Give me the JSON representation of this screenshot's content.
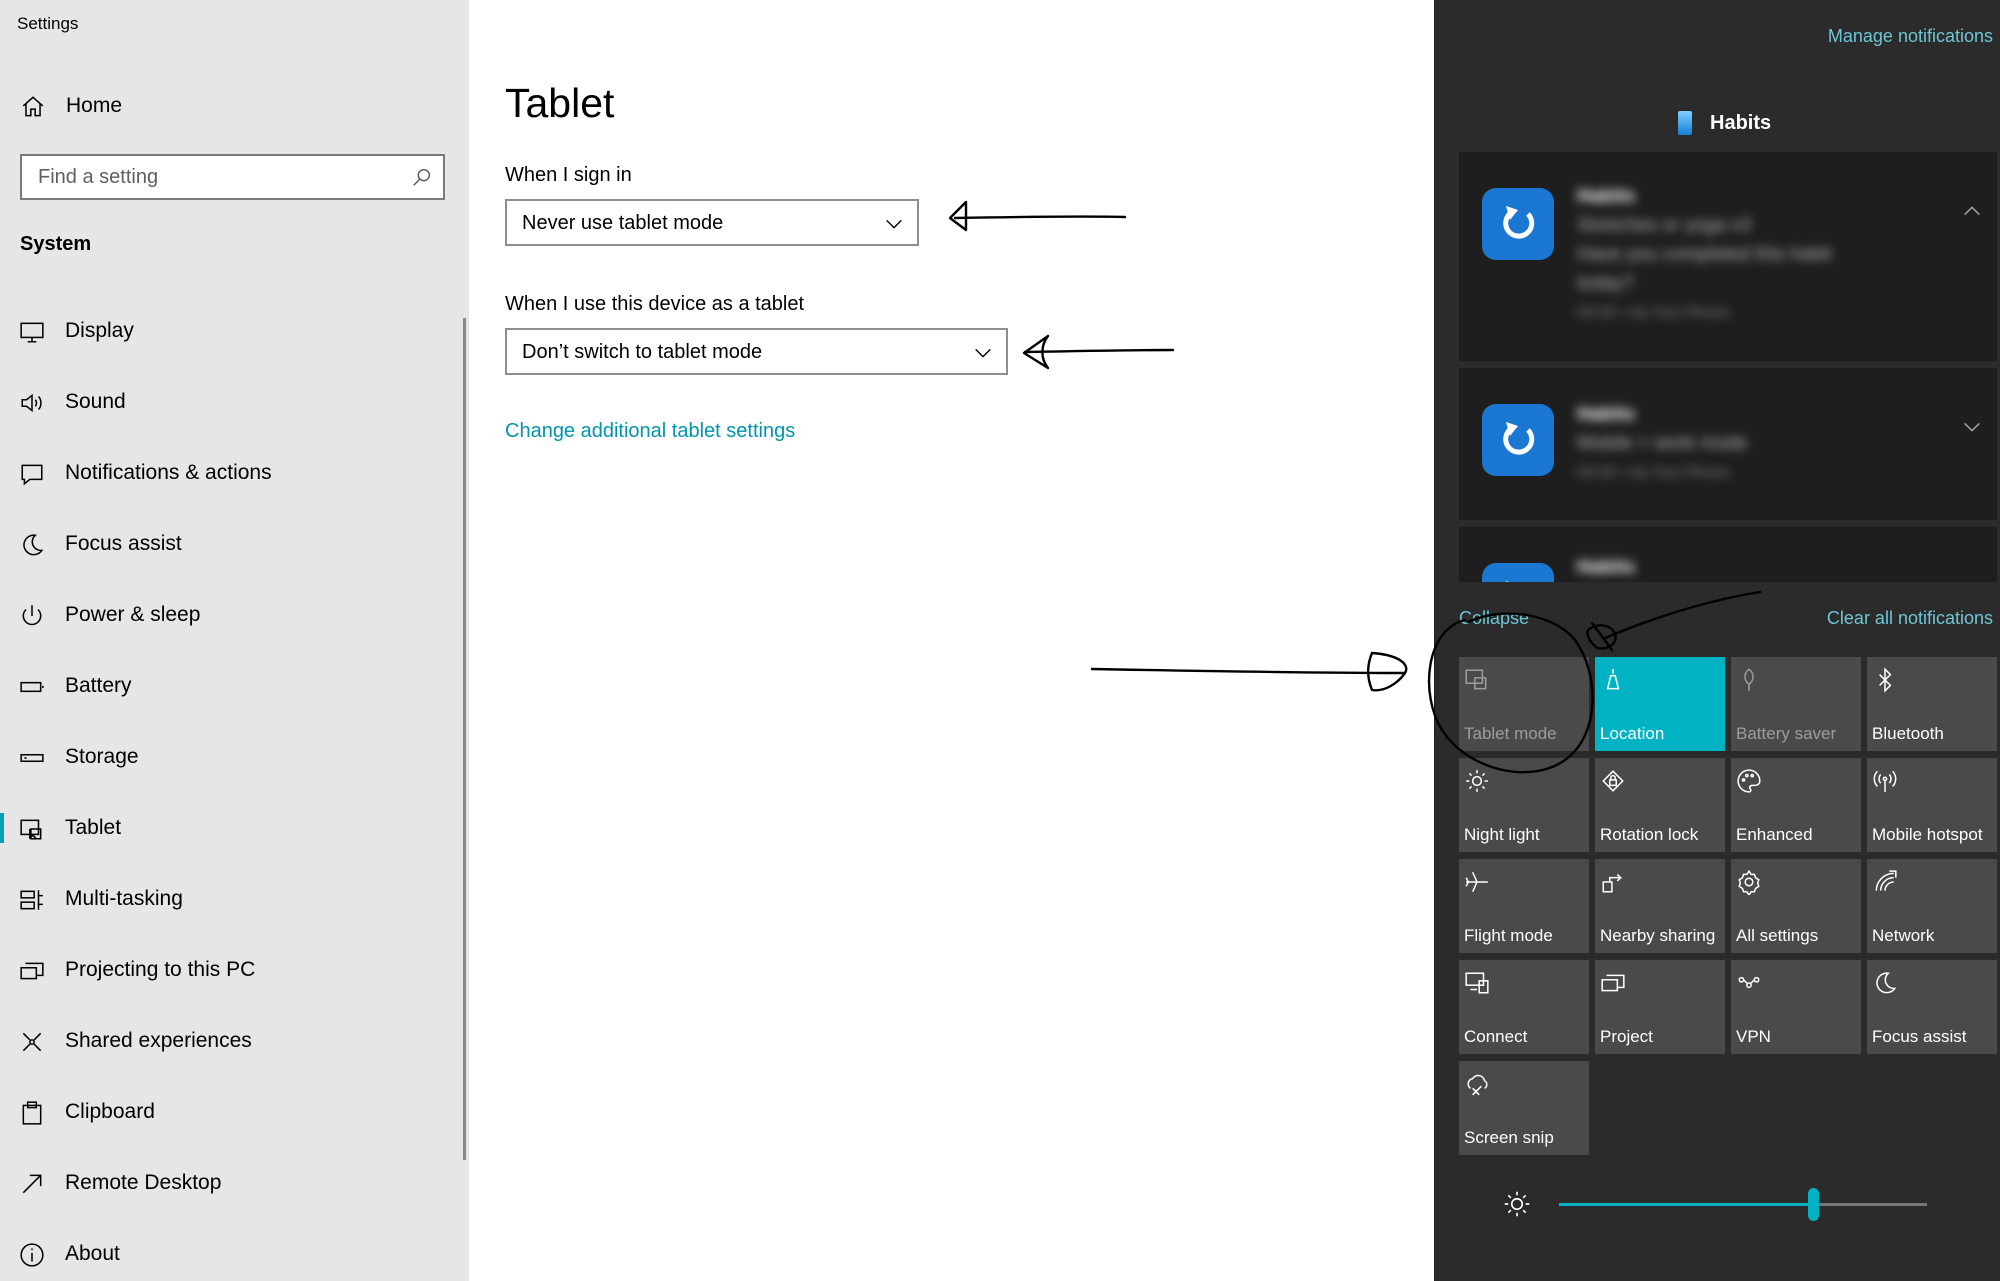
{
  "settings": {
    "app_title": "Settings",
    "home_label": "Home",
    "search_placeholder": "Find a setting",
    "section": "System",
    "nav": [
      {
        "label": "Display",
        "icon": "monitor-icon"
      },
      {
        "label": "Sound",
        "icon": "speaker-icon"
      },
      {
        "label": "Notifications & actions",
        "icon": "message-icon"
      },
      {
        "label": "Focus assist",
        "icon": "moon-icon"
      },
      {
        "label": "Power & sleep",
        "icon": "power-icon"
      },
      {
        "label": "Battery",
        "icon": "battery-icon"
      },
      {
        "label": "Storage",
        "icon": "storage-icon"
      },
      {
        "label": "Tablet",
        "icon": "tablet-icon",
        "active": true
      },
      {
        "label": "Multi-tasking",
        "icon": "multitasking-icon"
      },
      {
        "label": "Projecting to this PC",
        "icon": "project-icon"
      },
      {
        "label": "Shared experiences",
        "icon": "share-icon"
      },
      {
        "label": "Clipboard",
        "icon": "clipboard-icon"
      },
      {
        "label": "Remote Desktop",
        "icon": "remote-icon"
      },
      {
        "label": "About",
        "icon": "info-icon"
      }
    ]
  },
  "main": {
    "title": "Tablet",
    "sign_in_label": "When I sign in",
    "sign_in_value": "Never use tablet mode",
    "tablet_use_label": "When I use this device as a tablet",
    "tablet_use_value": "Don’t switch to tablet mode",
    "link": "Change additional tablet settings"
  },
  "action_center": {
    "manage_notifications": "Manage notifications",
    "app_group": "Habits",
    "notifications": [
      {
        "title": "Habits",
        "lines": [
          "Stretches or yoga x3",
          "Have you completed this habit",
          "today?"
        ],
        "meta": "09:30 • via Your Phone",
        "expanded": true
      },
      {
        "title": "Habits",
        "lines": [
          "Mobile > work mode"
        ],
        "meta": "09:30 • via Your Phone",
        "expanded": false
      },
      {
        "title": "Habits",
        "lines": [],
        "meta": "",
        "expanded": false
      }
    ],
    "collapse": "Collapse",
    "clear_all": "Clear all notifications",
    "quick_actions": [
      {
        "label": "Tablet mode",
        "icon": "tablet-mode-icon",
        "state": "disabled"
      },
      {
        "label": "Location",
        "icon": "location-icon",
        "state": "on"
      },
      {
        "label": "Battery saver",
        "icon": "battery-saver-icon",
        "state": "disabled"
      },
      {
        "label": "Bluetooth",
        "icon": "bluetooth-icon",
        "state": "off"
      },
      {
        "label": "Night light",
        "icon": "night-light-icon",
        "state": "off"
      },
      {
        "label": "Rotation lock",
        "icon": "rotation-lock-icon",
        "state": "off"
      },
      {
        "label": "Enhanced",
        "icon": "palette-icon",
        "state": "off"
      },
      {
        "label": "Mobile hotspot",
        "icon": "hotspot-icon",
        "state": "off"
      },
      {
        "label": "Flight mode",
        "icon": "airplane-icon",
        "state": "off"
      },
      {
        "label": "Nearby sharing",
        "icon": "nearby-share-icon",
        "state": "off"
      },
      {
        "label": "All settings",
        "icon": "gear-icon",
        "state": "off"
      },
      {
        "label": "Network",
        "icon": "network-icon",
        "state": "off"
      },
      {
        "label": "Connect",
        "icon": "connect-icon",
        "state": "off"
      },
      {
        "label": "Project",
        "icon": "project-icon",
        "state": "off"
      },
      {
        "label": "VPN",
        "icon": "vpn-icon",
        "state": "off"
      },
      {
        "label": "Focus assist",
        "icon": "moon-icon",
        "state": "off"
      },
      {
        "label": "Screen snip",
        "icon": "screen-snip-icon",
        "state": "off"
      }
    ],
    "brightness": 0.69
  },
  "colors": {
    "accent": "#00b3c4",
    "link": "#0095ad",
    "action_center_bg": "#2b2b2b",
    "tile_bg": "#4a4a4a"
  }
}
